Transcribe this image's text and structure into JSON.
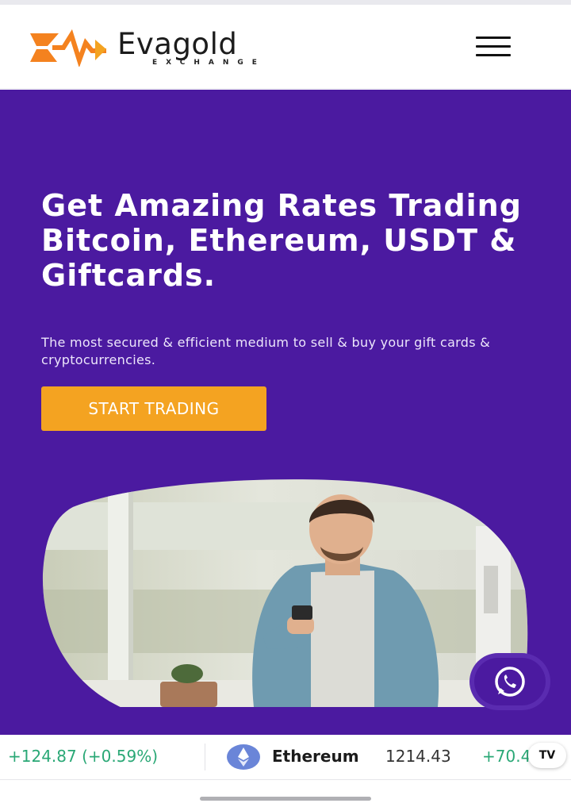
{
  "brand": {
    "name": "Evagold",
    "tagline": "EXCHANGE",
    "logo_icon": "evagold-logo-mark",
    "accent_color": "#f4a321"
  },
  "nav": {
    "menu_icon": "hamburger-menu-icon"
  },
  "hero": {
    "background_color": "#4b1aa0",
    "title": "Get Amazing Rates Trading Bitcoin, Ethereum, USDT & Giftcards.",
    "subtitle": "The most secured & efficient medium to sell & buy your gift cards & cryptocurrencies.",
    "cta_label": "START TRADING",
    "image": "man-using-smartphone-photo"
  },
  "chat": {
    "icon": "whatsapp-icon"
  },
  "ticker": {
    "items": [
      {
        "change": "+124.87 (+0.59%)"
      },
      {
        "icon": "ethereum-icon",
        "name": "Ethereum",
        "price": "1214.43",
        "change": "+70.4"
      }
    ],
    "badge": "TV",
    "positive_color": "#2aa876"
  }
}
